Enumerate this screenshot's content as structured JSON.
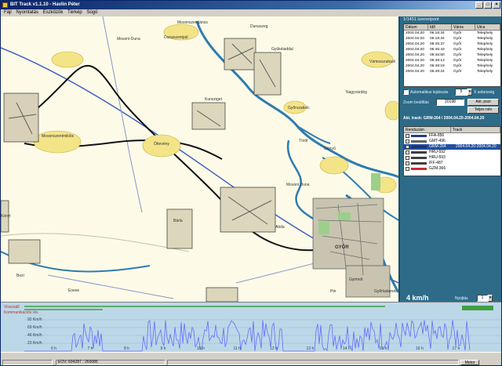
{
  "window": {
    "title": "BIT Track v1.1.10 - Havlin Péter"
  },
  "menu": [
    "Fájl",
    "Nyomtatás",
    "Eszközök",
    "Térkép",
    "Súgó"
  ],
  "map": {
    "labels": [
      "Dunaszeg",
      "Dunaszentpál",
      "Mosonszentjános",
      "Gyükéiaddal",
      "Mosoni-Duna",
      "Mosonszentmiklós",
      "Öttevény",
      "Kunsziget",
      "Győrszabolc",
      "Nagyvárdég",
      "Vámosszabadi",
      "Gönyű",
      "Töröl",
      "Mosoni Duna",
      "Gyirmót",
      "Bezi",
      "Enese",
      "Bárla",
      "Abda",
      "Pér",
      "Kónyi",
      "Győrladamér",
      "GYŐR"
    ]
  },
  "status_panel": {
    "count_label": "1/1451 üzenetpont",
    "columns": [
      "Dátum",
      "Idő",
      "Város",
      "Utca"
    ],
    "rows": [
      [
        "2004.04.20",
        "06:18:34",
        "Győr",
        "Telephely"
      ],
      [
        "2004.04.20",
        "06:18:34",
        "Győr",
        "Telephely"
      ],
      [
        "2004.04.20",
        "06:45:37",
        "Győr",
        "Telephely"
      ],
      [
        "2004.04.20",
        "06:45:43",
        "Győr",
        "Telephely"
      ],
      [
        "2004.04.20",
        "06:45:50",
        "Győr",
        "Telephely"
      ],
      [
        "2004.04.20",
        "06:48:13",
        "Győr",
        "Telephely"
      ],
      [
        "2004.04.20",
        "06:48:19",
        "Győr",
        "Telephely"
      ],
      [
        "2004.04.20",
        "06:48:24",
        "Győr",
        "Telephely"
      ]
    ]
  },
  "controls": {
    "auto_label": "Automatikus lejátszás",
    "auto_value": "5",
    "speed_mult_label": "X sebesség",
    "zoom_label": "Zoom beállítás",
    "zoom_value": "20198",
    "act_pos_button": "Akt. pozi",
    "full_view_button": "Teljes név",
    "active_track": "Akt. track: GRM-264 / 2004.04.20-2004.04.20"
  },
  "vehicles": {
    "columns": [
      "Rendszám",
      "Track"
    ],
    "rows": [
      {
        "plate": "FFA-856",
        "track": "",
        "color": "#204080",
        "selected": false
      },
      {
        "plate": "GMT-496",
        "track": "",
        "color": "#606060",
        "selected": false
      },
      {
        "plate": "GRM-264",
        "track": "2004.04.20-2004.04.20",
        "color": "#203070",
        "selected": true
      },
      {
        "plate": "HRU-592",
        "track": "",
        "color": "#404040",
        "selected": false
      },
      {
        "plate": "HRU-593",
        "track": "",
        "color": "#404040",
        "selected": false
      },
      {
        "plate": "IFF-487",
        "track": "",
        "color": "#404040",
        "selected": false
      },
      {
        "plate": "GZM-366",
        "track": "",
        "color": "#c03030",
        "selected": false
      }
    ]
  },
  "speed": {
    "value": "4 km/h",
    "zoom_label": "Nyújtás",
    "zoom_value": "1"
  },
  "graph": {
    "legend": [
      "Visszaáll",
      "Kommunikációs rés"
    ],
    "ylabels": [
      "92 Km/h",
      "69 Km/h",
      "46 Km/h",
      "23 Km/h"
    ],
    "xlabels": [
      "6 h",
      "7 h",
      "8 h",
      "9 h",
      "10 h",
      "11 h",
      "12 h",
      "13 h",
      "14 h",
      "15 h",
      "16 h",
      "17 h"
    ]
  },
  "statusbar": {
    "eov": "EOV: 694287 : 260085",
    "right": "Motor"
  }
}
